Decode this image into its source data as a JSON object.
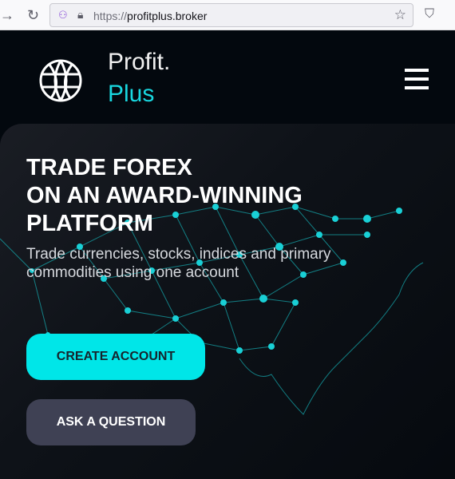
{
  "browser": {
    "url_protocol": "https://",
    "url_host": "profitplus.broker"
  },
  "header": {
    "brand_line1": "Profit.",
    "brand_line2": "Plus"
  },
  "hero": {
    "title_lines": [
      "TRADE FOREX",
      "ON AN AWARD-WINNING",
      "PLATFORM"
    ],
    "subtitle": "Trade currencies, stocks, indices and primary commodities using one account",
    "primary_button": "CREATE ACCOUNT",
    "secondary_button": "ASK A QUESTION"
  },
  "colors": {
    "accent": "#00e6e8",
    "background": "#03080e",
    "secondary_button": "#3f4154"
  }
}
